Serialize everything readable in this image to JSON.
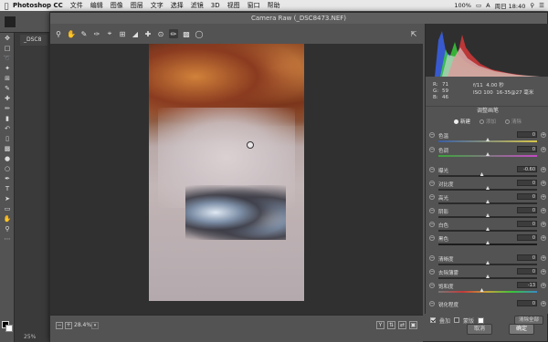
{
  "menubar": {
    "app_name": "Photoshop CC",
    "items": [
      "文件",
      "编辑",
      "图像",
      "图层",
      "文字",
      "选择",
      "滤镜",
      "3D",
      "视图",
      "窗口",
      "帮助"
    ],
    "battery": "100%",
    "ime": "A",
    "clock": "周日 18:40"
  },
  "document": {
    "tab_label": "_DSC8",
    "zoom_status": "25%"
  },
  "tools": [
    "move-icon",
    "marquee-icon",
    "lasso-icon",
    "magic-wand-icon",
    "crop-icon",
    "eyedropper-icon",
    "healing-brush-icon",
    "brush-icon",
    "clone-stamp-icon",
    "history-brush-icon",
    "eraser-icon",
    "gradient-icon",
    "blur-icon",
    "dodge-icon",
    "pen-icon",
    "type-icon",
    "path-select-icon",
    "rectangle-icon",
    "hand-icon",
    "zoom-icon"
  ],
  "dialog": {
    "title": "Camera Raw (_DSC8473.NEF)",
    "toolbar": [
      "zoom-icon",
      "hand-icon",
      "white-balance-icon",
      "color-sampler-icon",
      "targeted-adjust-icon",
      "crop-icon",
      "straighten-icon",
      "spot-removal-icon",
      "redeye-icon",
      "adjustment-brush-icon",
      "graduated-filter-icon",
      "radial-filter-icon"
    ],
    "zoom_value": "28.4%",
    "zoom_minus": "−",
    "zoom_plus": "+",
    "cancel_label": "取消",
    "done_label": "确定"
  },
  "readout": {
    "r_label": "R:",
    "r_value": "71",
    "g_label": "G:",
    "g_value": "59",
    "b_label": "B:",
    "b_value": "46",
    "aperture": "f/11",
    "shutter": "4.00 秒",
    "iso": "ISO 100",
    "lens": "16-35@27 毫米"
  },
  "panel": {
    "title": "调整画笔",
    "mode_new": "新建",
    "mode_add": "添加",
    "mode_erase": "清除"
  },
  "sliders": [
    {
      "label": "色温",
      "value": "0",
      "track": "temp",
      "level": 0.5
    },
    {
      "label": "色调",
      "value": "0",
      "track": "tint",
      "level": 0.5
    },
    {
      "label": "曝光",
      "value": "-0.60",
      "track": "",
      "level": 0.44
    },
    {
      "label": "对比度",
      "value": "0",
      "track": "",
      "level": 0.5
    },
    {
      "label": "高光",
      "value": "0",
      "track": "",
      "level": 0.5
    },
    {
      "label": "阴影",
      "value": "0",
      "track": "",
      "level": 0.5
    },
    {
      "label": "白色",
      "value": "0",
      "track": "",
      "level": 0.5
    },
    {
      "label": "黑色",
      "value": "0",
      "track": "",
      "level": 0.5
    },
    {
      "label": "清晰度",
      "value": "0",
      "track": "",
      "level": 0.5
    },
    {
      "label": "去除薄雾",
      "value": "0",
      "track": "",
      "level": 0.5
    },
    {
      "label": "饱和度",
      "value": "-13",
      "track": "sat",
      "level": 0.44
    },
    {
      "label": "锐化程度",
      "value": "0",
      "track": "",
      "level": 0.5
    }
  ],
  "overlay": {
    "overlay_label": "叠加",
    "mask_label": "蒙版",
    "clear_all_label": "清除全部"
  }
}
